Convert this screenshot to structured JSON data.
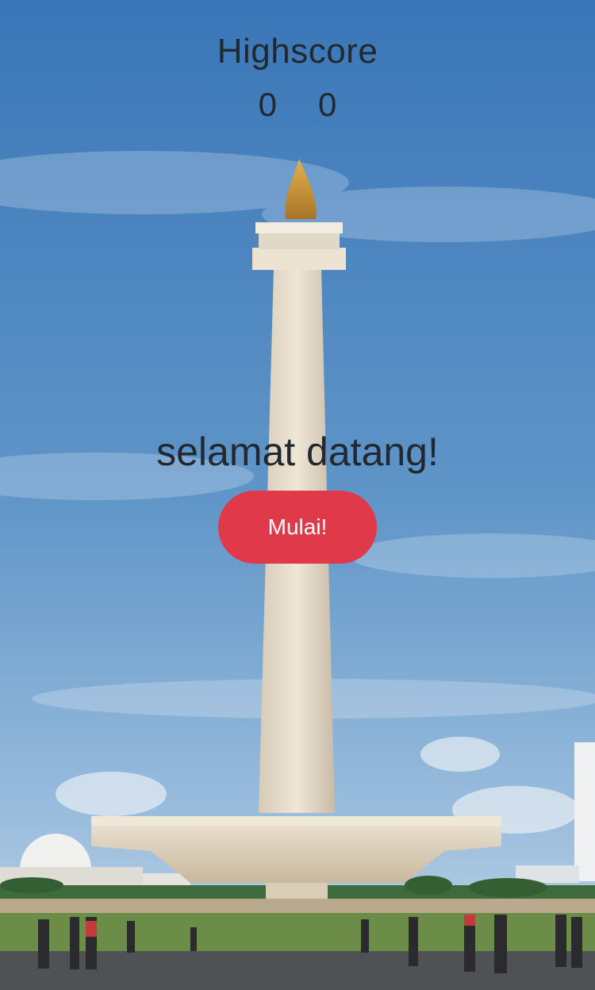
{
  "highscore": {
    "title": "Highscore",
    "scores": [
      "0",
      "0"
    ]
  },
  "welcome_text": "selamat datang!",
  "start_button": {
    "label": "Mulai!"
  },
  "colors": {
    "text": "#23282e",
    "button": "#e0394a",
    "button_text": "#ffffff",
    "sky": "#3f7cbf"
  },
  "background": {
    "subject": "monument-illustration"
  }
}
